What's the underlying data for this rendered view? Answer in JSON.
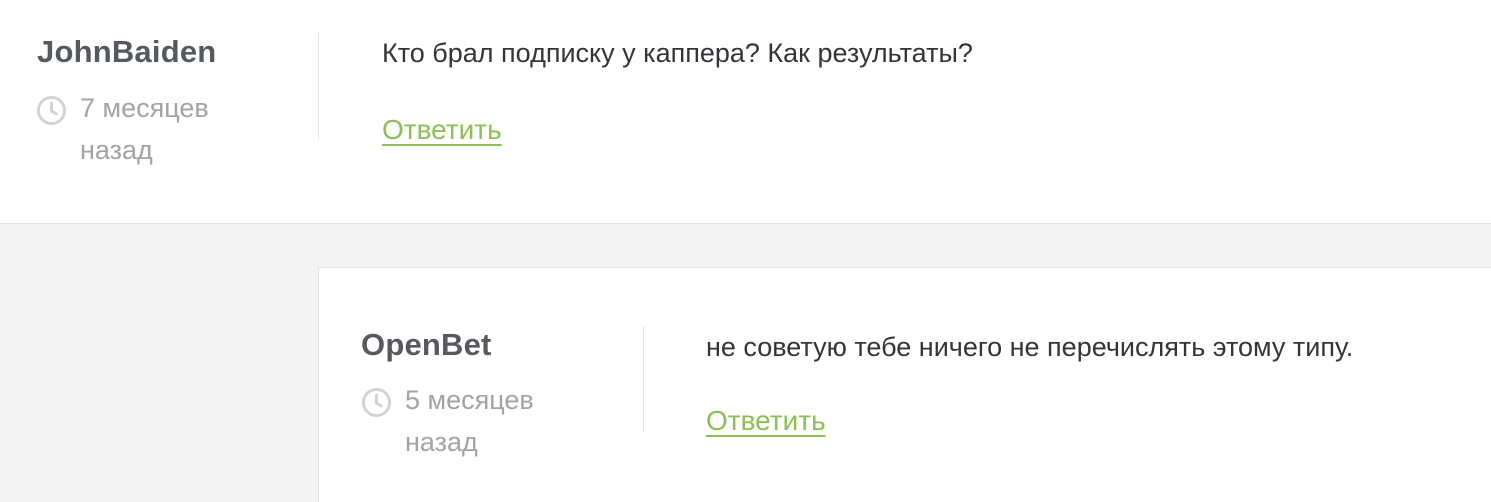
{
  "comments": [
    {
      "author": "JohnBaiden",
      "time": "7 месяцев назад",
      "text": "Кто брал подписку у каппера? Как результаты?",
      "reply_label": "Ответить"
    },
    {
      "author": "OpenBet",
      "time": "5 месяцев назад",
      "text": "не советую тебе ничего не перечислять этому типу.",
      "reply_label": "Ответить"
    }
  ],
  "icons": {
    "time": "clock-icon"
  },
  "colors": {
    "author": "#565a5f",
    "meta": "#a3a3a3",
    "text": "#333538",
    "link": "#8cc152",
    "background": "#f4f4f4",
    "card": "#ffffff",
    "border": "#e4e4e4"
  }
}
